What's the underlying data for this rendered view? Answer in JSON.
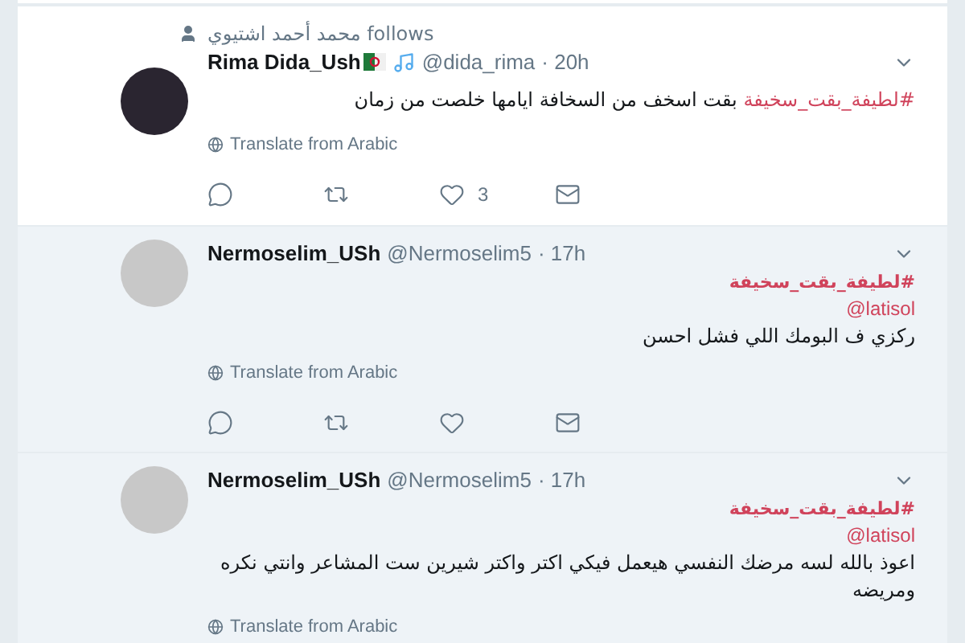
{
  "tweets": [
    {
      "kind": "inline",
      "highlighted": false,
      "social_context": "محمد أحمد اشتيوي follows",
      "name": "Rima Dida_Ush",
      "badges": [
        {
          "kind": "flag"
        },
        {
          "kind": "music"
        }
      ],
      "handle": "@dida_rima",
      "time": "· 20h",
      "hashtag": "#لطيفة_بقت_سخيفة",
      "text": "بقت اسخف من السخافة ايامها خلصت من زمان",
      "translate": "Translate from Arabic",
      "actions": [
        {
          "kind": "reply"
        },
        {
          "kind": "retweet"
        },
        {
          "kind": "like",
          "count": "3"
        },
        {
          "kind": "message"
        }
      ]
    },
    {
      "kind": "stacked",
      "highlighted": true,
      "name": "Nermoselim_USh",
      "handle": "@Nermoselim5",
      "time": "· 17h",
      "hashtag": "#لطيفة_بقت_سخيفة",
      "mention": "@latisol",
      "text": "ركزي ف البومك اللي فشل احسن",
      "translate": "Translate from Arabic",
      "actions": [
        {
          "kind": "reply"
        },
        {
          "kind": "retweet"
        },
        {
          "kind": "like"
        },
        {
          "kind": "message"
        }
      ]
    },
    {
      "kind": "stacked",
      "highlighted": true,
      "name": "Nermoselim_USh",
      "handle": "@Nermoselim5",
      "time": "· 17h",
      "hashtag": "#لطيفة_بقت_سخيفة",
      "mention": "@latisol",
      "text": "اعوذ بالله لسه مرضك النفسي هيعمل فيكي اكتر واكتر شيرين ست المشاعر وانتي نكره ومريضه",
      "translate": "Translate from Arabic"
    }
  ]
}
